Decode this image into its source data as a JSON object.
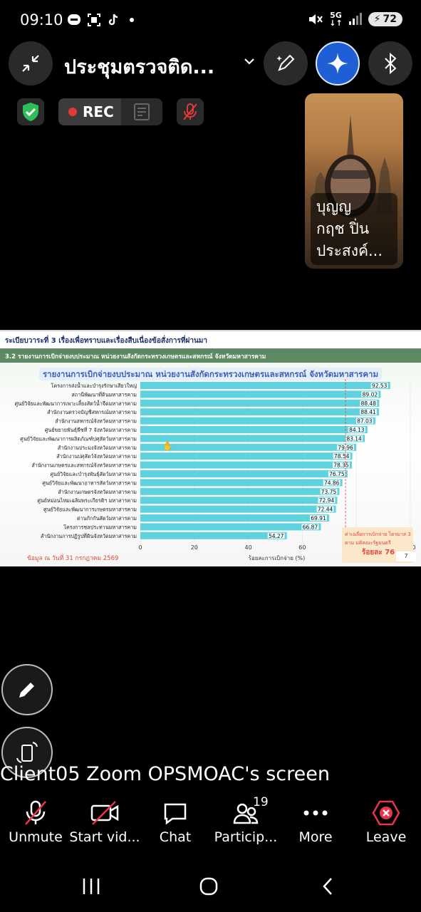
{
  "status_bar": {
    "time": "09:10",
    "network": "5G",
    "battery": "72"
  },
  "meeting": {
    "title": "ประชุมตรวจติด...",
    "rec_label": "REC",
    "participant_tile_name": "บุญญ\nกฤช ปิ่น\nประสงค์...",
    "screen_share_label": "Client05 Zoom OPSMOAC's screen"
  },
  "shared_slide": {
    "header": "ระเบียบวาระที่ 3 เรื่องเพื่อทราบและเรื่องสืบเนื่องข้อสั่งการที่ผ่านมา",
    "subheader": "3.2 รายงานการเบิกจ่ายงบประมาณ หน่วยงานสังกัดกระทรวงเกษตรและสหกรณ์ จังหวัดมหาสารคาม",
    "footnote": "ข้อมูล ณ วันที่ 31 กรกฎาคม 2569",
    "page_number": "7",
    "target_note_line1": "ค่าเฉลี่ยการเบิกจ่าย ไตรมาส 3",
    "target_note_line2": "ตาม มติคณะรัฐมนตรี",
    "target_note_value": "ร้อยละ 76"
  },
  "chart_data": {
    "type": "bar",
    "orientation": "horizontal",
    "title": "รายงานการเบิกจ่ายงบประมาณ หน่วยงานสังกัดกระทรวงเกษตรและสหกรณ์ จังหวัดมหาสารคาม",
    "xlabel": "ร้อยละการเบิกจ่าย (%)",
    "ylabel": "",
    "xlim": [
      0,
      100
    ],
    "xticks": [
      "0",
      "20",
      "40",
      "60",
      "80",
      "100"
    ],
    "target_line": 76,
    "bar_color": "#5ed3dd",
    "categories": [
      "โครงการส่งน้ำและบำรุงรักษาเสียวใหญ่",
      "สถานีพัฒนาที่ดินมหาสารคาม",
      "ศูนย์วิจัยและพัฒนาการเพาะเลี้ยงสัตว์น้ำจืดมหาสารคาม",
      "สำนักงานตรวจบัญชีสหกรณ์มหาสารคาม",
      "สำนักงานสหกรณ์จังหวัดมหาสารคาม",
      "ศูนย์ขยายพันธุ์พืชที่ 7 จังหวัดมหาสารคาม",
      "ศูนย์วิจัยและพัฒนาการผลิตภัณฑ์ปศุสัตว์มหาสารคาม",
      "สำนักงานประมงจังหวัดมหาสารคาม",
      "สำนักงานปศุสัตว์จังหวัดมหาสารคาม",
      "สำนักงานเกษตรและสหกรณ์จังหวัดมหาสารคาม",
      "ศูนย์วิจัยและบำรุงพันธุ์สัตว์มหาสารคาม",
      "ศูนย์วิจัยและพัฒนาอาหารสัตว์มหาสารคาม",
      "สำนักงานเกษตรจังหวัดมหาสารคาม",
      "ศูนย์หม่อนไหมเฉลิมพระเกียรติฯ มหาสารคาม",
      "ศูนย์วิจัยและพัฒนาการเกษตรมหาสารคาม",
      "ด่านกักกันสัตว์มหาสารคาม",
      "โครงการชลประทานมหาสารคาม",
      "สำนักงานการปฏิรูปที่ดินจังหวัดมหาสารคาม"
    ],
    "values": [
      92.53,
      89.02,
      88.48,
      88.41,
      87.03,
      84.13,
      83.14,
      79.96,
      78.54,
      78.35,
      76.75,
      74.86,
      73.75,
      72.94,
      72.44,
      69.91,
      66.87,
      54.27
    ],
    "value_labels": [
      "92.53",
      "89.02",
      "88.48",
      "88.41",
      "87.03",
      "84.13",
      "83.14",
      "79.96",
      "78.54",
      "78.35",
      "76.75",
      "74.86",
      "73.75",
      "72.94",
      "72.44",
      "69.91",
      "66.87",
      "54.27"
    ]
  },
  "toolbar": {
    "unmute": "Unmute",
    "start_video": "Start vid...",
    "chat": "Chat",
    "participants": "Particip...",
    "participants_count": "19",
    "more": "More",
    "leave": "Leave"
  },
  "colors": {
    "leave_red": "#e8354a",
    "shield_green": "#2fbf5a",
    "rec_red": "#e53935",
    "ai_button_blue": "#1f5fd6"
  }
}
